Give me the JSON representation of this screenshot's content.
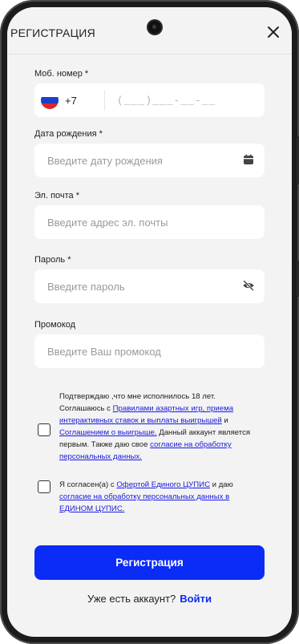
{
  "header": {
    "title": "РЕГИСТРАЦИЯ"
  },
  "phone_field": {
    "label": "Моб. номер *",
    "country_code": "+7",
    "mask": "(___)___-__-__"
  },
  "birth_field": {
    "label": "Дата рождения *",
    "placeholder": "Введите дату рождения"
  },
  "email_field": {
    "label": "Эл. почта *",
    "placeholder": "Введите адрес эл. почты"
  },
  "password_field": {
    "label": "Пароль *",
    "placeholder": "Введите пароль"
  },
  "promo_field": {
    "label": "Промокод",
    "placeholder": "Введите Ваш промокод"
  },
  "consent_age": {
    "t1": "Подтверждаю ,что мне исполнилось 18 лет. Соглашаюсь с ",
    "link1": "Правилами азартных игр, приема интерактивных ставок и выплаты выигрышей",
    "t2": " и ",
    "link2": "Соглашением о выигрыше.",
    "t3": " Данный аккаунт является первым. Также даю свое ",
    "link3": "согласие на обработку персональных данных."
  },
  "consent_cupis": {
    "t1": "Я согласен(а) с ",
    "link1": "Офертой Единого ЦУПИС",
    "t2": " и даю ",
    "link2": "согласие на обработку персональных данных в ЕДИНОМ ЦУПИС."
  },
  "submit_label": "Регистрация",
  "footer": {
    "text": "Уже есть аккаунт?",
    "login_label": "Войти"
  },
  "colors": {
    "accent": "#0b2bf7",
    "link": "#1a1adf",
    "background": "#f3f3f3",
    "flag": [
      "#ffffff",
      "#1c3fc7",
      "#e0262b"
    ]
  }
}
